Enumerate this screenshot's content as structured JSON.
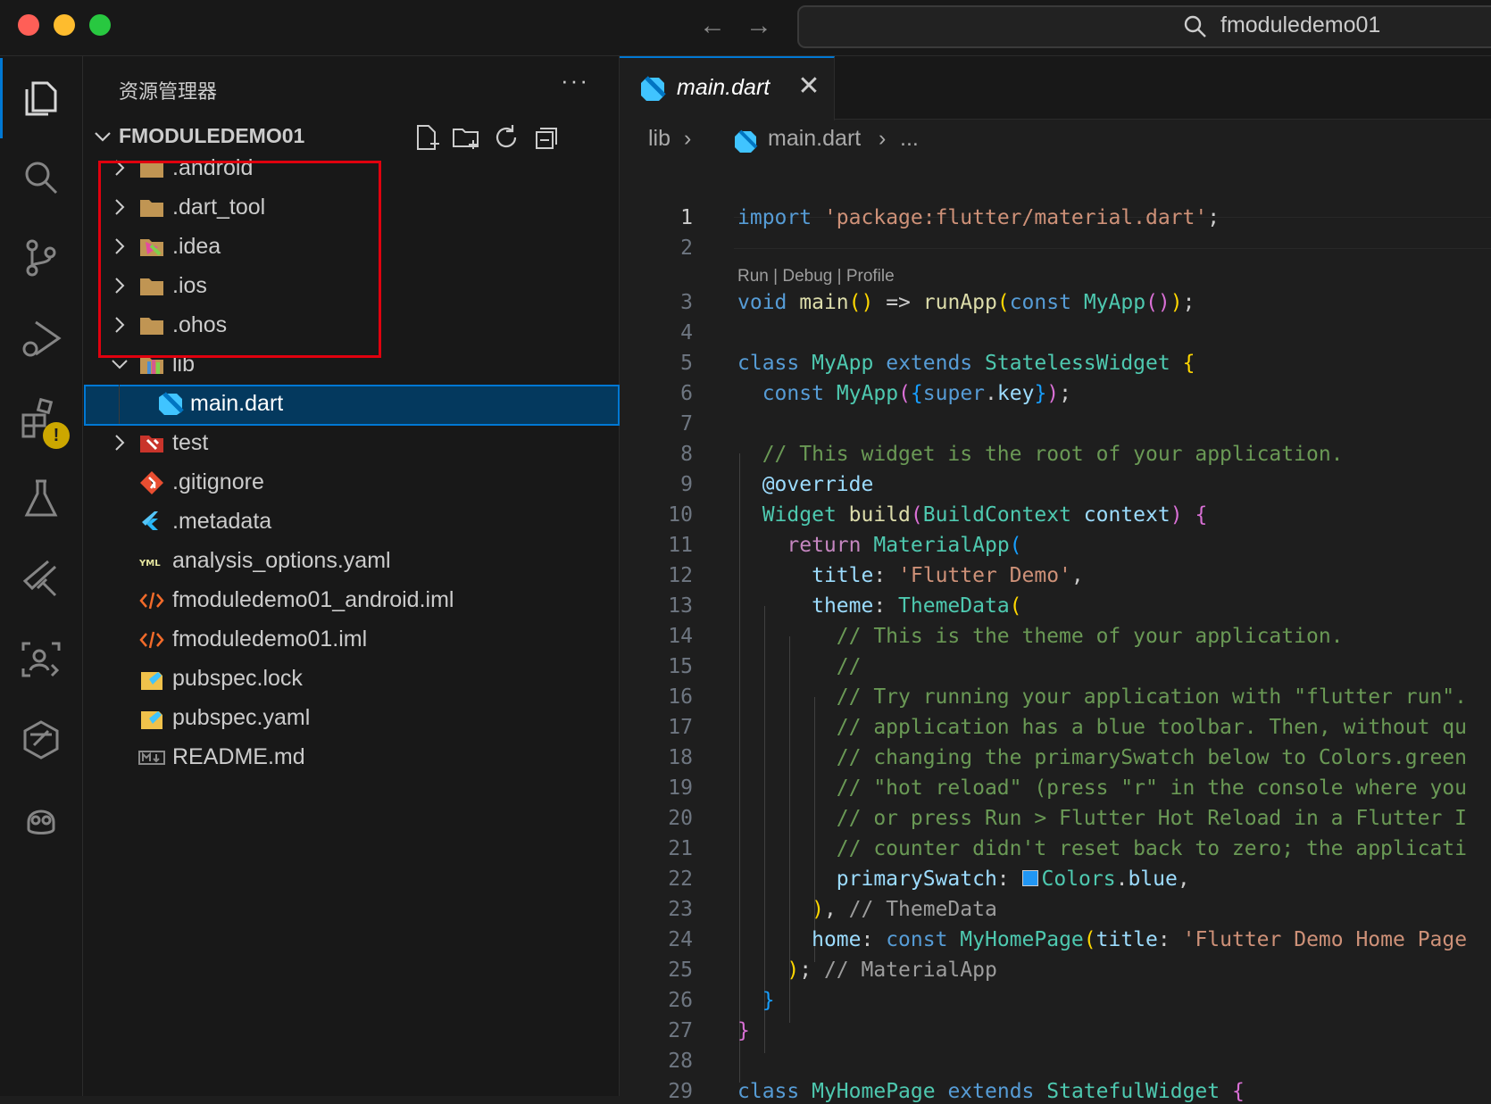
{
  "window": {
    "colors": {
      "close": "#ff5f57",
      "minimize": "#febc2e",
      "zoom": "#28c840",
      "accent": "#0078d4",
      "highlight": "#e0000e"
    },
    "nav_back": "←",
    "nav_forward": "→",
    "search_text": "fmoduledemo01"
  },
  "activity_bar": {
    "icons": [
      "explorer-icon",
      "search-icon",
      "source-control-icon",
      "run-debug-icon",
      "extensions-icon",
      "testing-icon",
      "flutter-icon",
      "remote-explorer-icon",
      "deveco-icon",
      "copilot-icon"
    ],
    "extensions_badge": "!"
  },
  "sidebar": {
    "title": "资源管理器",
    "more": "···",
    "root_label": "FMODULEDEMO01",
    "items": [
      {
        "label": ".android",
        "icon": "folder-icon"
      },
      {
        "label": ".dart_tool",
        "icon": "folder-icon"
      },
      {
        "label": ".idea",
        "icon": "idea-folder-icon"
      },
      {
        "label": ".ios",
        "icon": "folder-icon"
      },
      {
        "label": ".ohos",
        "icon": "folder-icon"
      },
      {
        "label": "lib",
        "icon": "lib-folder-icon"
      },
      {
        "label": "main.dart",
        "icon": "dart-file-icon"
      },
      {
        "label": "test",
        "icon": "test-folder-icon"
      },
      {
        "label": ".gitignore",
        "icon": "git-file-icon"
      },
      {
        "label": ".metadata",
        "icon": "flutter-file-icon"
      },
      {
        "label": "analysis_options.yaml",
        "icon": "yaml-file-icon"
      },
      {
        "label": "fmoduledemo01_android.iml",
        "icon": "xml-file-icon"
      },
      {
        "label": "fmoduledemo01.iml",
        "icon": "xml-file-icon"
      },
      {
        "label": "pubspec.lock",
        "icon": "pubspec-file-icon"
      },
      {
        "label": "pubspec.yaml",
        "icon": "pubspec-file-icon"
      },
      {
        "label": "README.md",
        "icon": "markdown-file-icon"
      }
    ]
  },
  "editor": {
    "tab_label": "main.dart",
    "tab_close": "✕",
    "breadcrumb": [
      "lib",
      "main.dart",
      "..."
    ],
    "codelens": "Run | Debug | Profile",
    "line_numbers": [
      "1",
      "2",
      "3",
      "4",
      "5",
      "6",
      "7",
      "8",
      "9",
      "10",
      "11",
      "12",
      "13",
      "14",
      "15",
      "16",
      "17",
      "18",
      "19",
      "20",
      "21",
      "22",
      "23",
      "24",
      "25",
      "26",
      "27",
      "28",
      "29"
    ],
    "code_lines": [
      "import 'package:flutter/material.dart';",
      "",
      "void main() => runApp(const MyApp());",
      "",
      "class MyApp extends StatelessWidget {",
      "  const MyApp({super.key});",
      "",
      "  // This widget is the root of your application.",
      "  @override",
      "  Widget build(BuildContext context) {",
      "    return MaterialApp(",
      "      title: 'Flutter Demo',",
      "      theme: ThemeData(",
      "        // This is the theme of your application.",
      "        //",
      "        // Try running your application with \"flutter run\".",
      "        // application has a blue toolbar. Then, without qu",
      "        // changing the primarySwatch below to Colors.green",
      "        // \"hot reload\" (press \"r\" in the console where you",
      "        // or press Run > Flutter Hot Reload in a Flutter I",
      "        // counter didn't reset back to zero; the applicati",
      "        primarySwatch: Colors.blue,",
      "      ), // ThemeData",
      "      home: const MyHomePage(title: 'Flutter Demo Home Page",
      "    ); // MaterialApp",
      "  }",
      "}",
      "",
      "class MyHomePage extends StatefulWidget {"
    ]
  }
}
